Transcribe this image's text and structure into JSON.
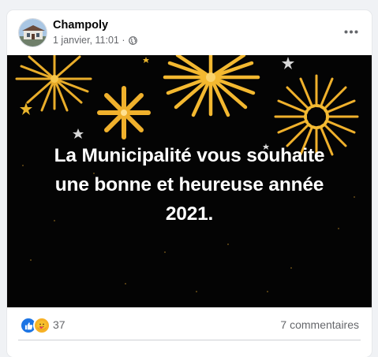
{
  "post": {
    "author": "Champoly",
    "date": "1 janvier, 11:01 ·",
    "privacy_icon": "globe-icon",
    "more_icon": "more-options-icon"
  },
  "image": {
    "greeting_lines": [
      "La Municipalité vous souhaite",
      "une bonne et heureuse année",
      "2021."
    ],
    "colors": {
      "background": "#040404",
      "firework_gold": "#f2b630",
      "text": "#ffffff"
    }
  },
  "footer": {
    "reaction_icons": [
      "like-icon",
      "care-icon"
    ],
    "reaction_count": "37",
    "comments": "7 commentaires"
  }
}
